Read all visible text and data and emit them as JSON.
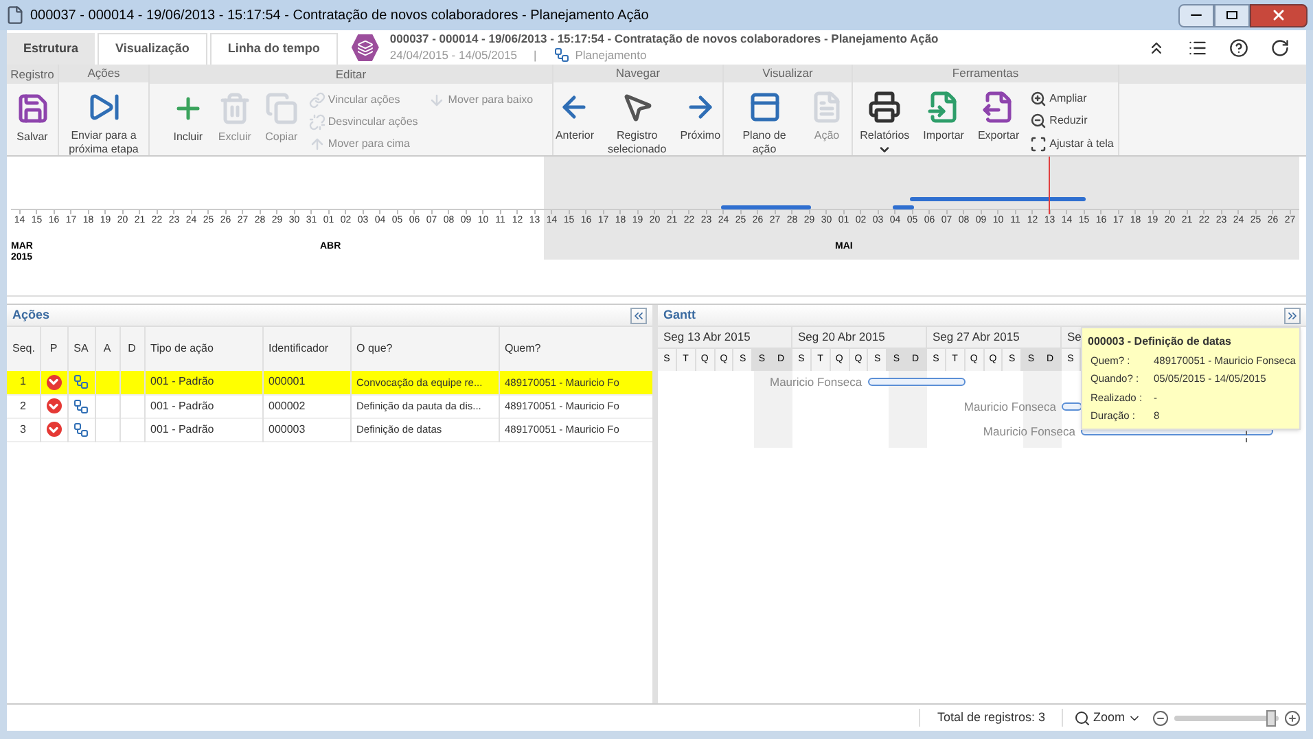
{
  "window": {
    "title": "000037 - 000014 - 19/06/2013 - 15:17:54 - Contratação de novos colaboradores - Planejamento Ação"
  },
  "tabs": [
    {
      "label": "Estrutura",
      "selected": true
    },
    {
      "label": "Visualização",
      "selected": false
    },
    {
      "label": "Linha do tempo",
      "selected": false
    }
  ],
  "record": {
    "title": "000037 - 000014 - 19/06/2013 - 15:17:54 - Contratação de novos colaboradores - Planejamento Ação",
    "dates": "24/04/2015 - 14/05/2015",
    "separator": "|",
    "stage": "Planejamento"
  },
  "ribbon": {
    "groups": [
      {
        "label": "Registro",
        "buttons": [
          {
            "label": "Salvar",
            "kind": "large",
            "disabled": false
          }
        ]
      },
      {
        "label": "Ações",
        "buttons": [
          {
            "label": "Enviar para a próxima etapa",
            "kind": "large",
            "disabled": false
          }
        ]
      },
      {
        "label": "Editar",
        "buttons": [
          {
            "label": "Incluir",
            "kind": "large",
            "disabled": false
          },
          {
            "label": "Excluir",
            "kind": "large",
            "disabled": true
          },
          {
            "label": "Copiar",
            "kind": "large",
            "disabled": true
          },
          {
            "label": "Vincular ações",
            "kind": "small",
            "disabled": true
          },
          {
            "label": "Desvincular ações",
            "kind": "small",
            "disabled": true
          },
          {
            "label": "Mover para cima",
            "kind": "small",
            "disabled": true
          },
          {
            "label": "Mover para baixo",
            "kind": "small",
            "disabled": true
          }
        ]
      },
      {
        "label": "Navegar",
        "buttons": [
          {
            "label": "Anterior",
            "kind": "large",
            "disabled": false
          },
          {
            "label": "Registro selecionado",
            "kind": "large",
            "disabled": false
          },
          {
            "label": "Próximo",
            "kind": "large",
            "disabled": false
          }
        ]
      },
      {
        "label": "Visualizar",
        "buttons": [
          {
            "label": "Plano de ação",
            "kind": "large",
            "disabled": false
          },
          {
            "label": "Ação",
            "kind": "large",
            "disabled": true
          }
        ]
      },
      {
        "label": "Ferramentas",
        "buttons": [
          {
            "label": "Relatórios",
            "kind": "menu",
            "disabled": false
          },
          {
            "label": "Importar",
            "kind": "large",
            "disabled": false
          },
          {
            "label": "Exportar",
            "kind": "large",
            "disabled": false
          },
          {
            "label": "Ampliar",
            "kind": "small",
            "disabled": false
          },
          {
            "label": "Reduzir",
            "kind": "small",
            "disabled": false
          },
          {
            "label": "Ajustar à tela",
            "kind": "small",
            "disabled": false
          }
        ]
      }
    ]
  },
  "timeline": {
    "days": [
      {
        "day": "14",
        "month": "MAR",
        "year": "2015",
        "highlighted": false
      },
      {
        "day": "15",
        "highlighted": false
      },
      {
        "day": "16",
        "highlighted": false
      },
      {
        "day": "17",
        "highlighted": false
      },
      {
        "day": "18",
        "highlighted": false
      },
      {
        "day": "19",
        "highlighted": false
      },
      {
        "day": "20",
        "highlighted": false
      },
      {
        "day": "21",
        "highlighted": false
      },
      {
        "day": "22",
        "highlighted": false
      },
      {
        "day": "23",
        "highlighted": false
      },
      {
        "day": "24",
        "highlighted": false
      },
      {
        "day": "25",
        "highlighted": false
      },
      {
        "day": "26",
        "highlighted": false
      },
      {
        "day": "27",
        "highlighted": false
      },
      {
        "day": "28",
        "highlighted": false
      },
      {
        "day": "29",
        "highlighted": false
      },
      {
        "day": "30",
        "highlighted": false
      },
      {
        "day": "31",
        "highlighted": false
      },
      {
        "day": "01",
        "month": "ABR",
        "highlighted": false
      },
      {
        "day": "02",
        "highlighted": false
      },
      {
        "day": "03",
        "highlighted": false
      },
      {
        "day": "04",
        "highlighted": false
      },
      {
        "day": "05",
        "highlighted": false
      },
      {
        "day": "06",
        "highlighted": false
      },
      {
        "day": "07",
        "highlighted": false
      },
      {
        "day": "08",
        "highlighted": false
      },
      {
        "day": "09",
        "highlighted": false
      },
      {
        "day": "10",
        "highlighted": false
      },
      {
        "day": "11",
        "highlighted": false
      },
      {
        "day": "12",
        "highlighted": false
      },
      {
        "day": "13",
        "highlighted": false
      },
      {
        "day": "14",
        "highlighted": true
      },
      {
        "day": "15",
        "highlighted": true
      },
      {
        "day": "16",
        "highlighted": true
      },
      {
        "day": "17",
        "highlighted": true
      },
      {
        "day": "18",
        "highlighted": true
      },
      {
        "day": "19",
        "highlighted": true
      },
      {
        "day": "20",
        "highlighted": true
      },
      {
        "day": "21",
        "highlighted": true
      },
      {
        "day": "22",
        "highlighted": true
      },
      {
        "day": "23",
        "highlighted": true
      },
      {
        "day": "24",
        "highlighted": true
      },
      {
        "day": "25",
        "highlighted": true
      },
      {
        "day": "26",
        "highlighted": true
      },
      {
        "day": "27",
        "highlighted": true
      },
      {
        "day": "28",
        "highlighted": true
      },
      {
        "day": "29",
        "highlighted": true
      },
      {
        "day": "30",
        "highlighted": true
      },
      {
        "day": "01",
        "month": "MAI",
        "highlighted": true
      },
      {
        "day": "02",
        "highlighted": true
      },
      {
        "day": "03",
        "highlighted": true
      },
      {
        "day": "04",
        "highlighted": true
      },
      {
        "day": "05",
        "highlighted": true
      },
      {
        "day": "06",
        "highlighted": true
      },
      {
        "day": "07",
        "highlighted": true
      },
      {
        "day": "08",
        "highlighted": true
      },
      {
        "day": "09",
        "highlighted": true
      },
      {
        "day": "10",
        "highlighted": true
      },
      {
        "day": "11",
        "highlighted": true
      },
      {
        "day": "12",
        "highlighted": true
      },
      {
        "day": "13",
        "highlighted": true
      },
      {
        "day": "14",
        "highlighted": true
      },
      {
        "day": "15",
        "highlighted": true
      },
      {
        "day": "16",
        "highlighted": true
      },
      {
        "day": "17",
        "highlighted": true
      },
      {
        "day": "18",
        "highlighted": true
      },
      {
        "day": "19",
        "highlighted": true
      },
      {
        "day": "20",
        "highlighted": true
      },
      {
        "day": "21",
        "highlighted": true
      },
      {
        "day": "22",
        "highlighted": true
      },
      {
        "day": "23",
        "highlighted": true
      },
      {
        "day": "24",
        "highlighted": true
      },
      {
        "day": "25",
        "highlighted": true
      },
      {
        "day": "26",
        "highlighted": true
      },
      {
        "day": "27",
        "highlighted": true
      }
    ]
  },
  "actions_panel": {
    "title": "Ações",
    "columns": [
      "Seq.",
      "P",
      "SA",
      "A",
      "D",
      "Tipo de ação",
      "Identificador",
      "O que?",
      "Quem?"
    ],
    "rows": [
      {
        "seq": "1",
        "type": "001 - Padrão",
        "id": "000001",
        "what": "Convocação da equipe re...",
        "who": "489170051 - Mauricio Fo",
        "selected": true
      },
      {
        "seq": "2",
        "type": "001 - Padrão",
        "id": "000002",
        "what": "Definição da pauta da dis...",
        "who": "489170051 - Mauricio Fo",
        "selected": false
      },
      {
        "seq": "3",
        "type": "001 - Padrão",
        "id": "000003",
        "what": "Definição de datas",
        "who": "489170051 - Mauricio Fo",
        "selected": false
      }
    ]
  },
  "gantt": {
    "title": "Gantt",
    "weeks": [
      {
        "label": "Seg 13 Abr 2015",
        "days": [
          {
            "letter": "S",
            "weekend": false
          },
          {
            "letter": "T",
            "weekend": false
          },
          {
            "letter": "Q",
            "weekend": false
          },
          {
            "letter": "Q",
            "weekend": false
          },
          {
            "letter": "S",
            "weekend": false
          },
          {
            "letter": "S",
            "weekend": true
          },
          {
            "letter": "D",
            "weekend": true
          }
        ]
      },
      {
        "label": "Seg 20 Abr 2015",
        "days": [
          {
            "letter": "S",
            "weekend": false
          },
          {
            "letter": "T",
            "weekend": false
          },
          {
            "letter": "Q",
            "weekend": false
          },
          {
            "letter": "Q",
            "weekend": false
          },
          {
            "letter": "S",
            "weekend": false
          },
          {
            "letter": "S",
            "weekend": true
          },
          {
            "letter": "D",
            "weekend": true
          }
        ]
      },
      {
        "label": "Seg 27 Abr 2015",
        "days": [
          {
            "letter": "S",
            "weekend": false
          },
          {
            "letter": "T",
            "weekend": false
          },
          {
            "letter": "Q",
            "weekend": false
          },
          {
            "letter": "Q",
            "weekend": false
          },
          {
            "letter": "S",
            "weekend": false
          },
          {
            "letter": "S",
            "weekend": true
          },
          {
            "letter": "D",
            "weekend": true
          }
        ]
      },
      {
        "label": "Se",
        "days": [
          {
            "letter": "S",
            "weekend": false
          }
        ]
      }
    ],
    "rows": [
      {
        "name": "Mauricio Fonseca"
      },
      {
        "name": "Mauricio Fonseca"
      },
      {
        "name": "Mauricio Fonseca"
      }
    ],
    "tooltip": {
      "title": "000003 - Definição de datas",
      "fields": [
        {
          "label": "Quem? :",
          "value": "489170051 - Mauricio Fonseca"
        },
        {
          "label": "Quando? :",
          "value": "05/05/2015 - 14/05/2015"
        },
        {
          "label": "Realizado :",
          "value": "-"
        },
        {
          "label": "Duração :",
          "value": "8"
        }
      ]
    }
  },
  "status_bar": {
    "total": "Total de registros: 3",
    "zoom": "Zoom",
    "level": 0.93
  }
}
